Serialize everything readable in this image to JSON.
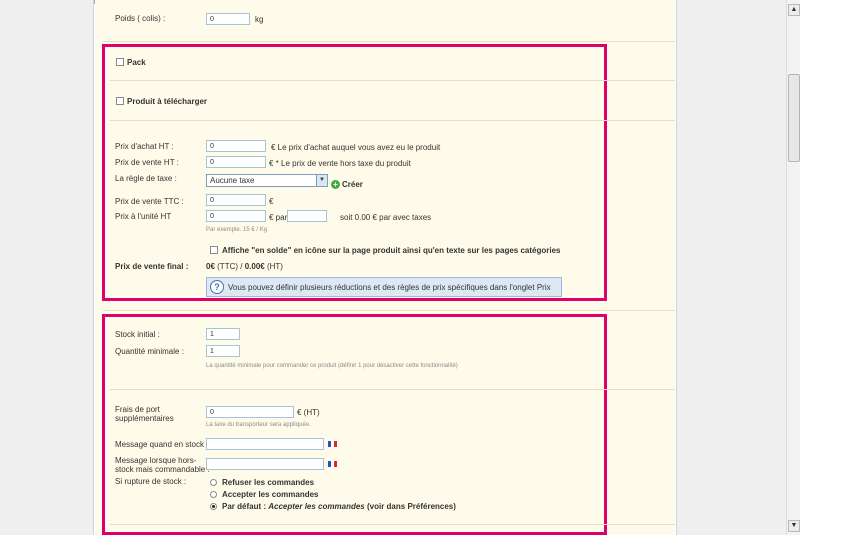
{
  "top": {
    "weight_label": "Poids ( colis) :",
    "weight_value": "0",
    "weight_unit": "kg"
  },
  "options": {
    "pack_label": "Pack",
    "download_label": "Produit à télécharger"
  },
  "prices": {
    "purchase_label": "Prix d'achat HT :",
    "purchase_value": "0",
    "purchase_note": "€  Le prix d'achat auquel vous avez eu le produit",
    "sale_ht_label": "Prix de vente HT :",
    "sale_ht_value": "0",
    "sale_ht_note": "€ *  Le prix de vente hors taxe du produit",
    "tax_rule_label": "La règle de taxe :",
    "tax_rule_selected": "Aucune taxe",
    "create_label": "Créer",
    "sale_ttc_label": "Prix de vente TTC :",
    "sale_ttc_value": "0",
    "sale_ttc_unit": "€",
    "unit_price_label": "Prix à l'unité HT",
    "unit_price_value": "0",
    "unit_price_per": "€ par",
    "unit_price_per_value": "",
    "unit_price_note": "soit 0.00 € par avec taxes",
    "unit_example": "Par exemple. 15 € / Kg",
    "on_sale_label": "Affiche \"en solde\" en icône sur la page produit ainsi qu'en texte sur les pages catégories",
    "final_label": "Prix de vente final :",
    "final_ttc": "0€",
    "final_ttc_suffix": "(TTC) /",
    "final_ht": "0.00€",
    "final_ht_suffix": "(HT)",
    "info_text": "Vous pouvez définir plusieurs réductions et des règles de prix spécifiques dans l'onglet Prix"
  },
  "stock": {
    "initial_label": "Stock initial :",
    "initial_value": "1",
    "min_qty_label": "Quantité minimale :",
    "min_qty_value": "1",
    "min_qty_hint": "La quantité minimale pour commander ce produit (définir 1 pour désactiver cette fonctionnalité)",
    "shipping_label_1": "Frais de port",
    "shipping_label_2": "supplémentaires",
    "shipping_value": "0",
    "shipping_unit": "€ (HT)",
    "shipping_hint": "La taxe du transporteur sera appliquée.",
    "msg_in_stock_label": "Message quand en stock :",
    "msg_in_stock_value": "",
    "msg_backorder_label_1": "Message lorsque hors-",
    "msg_backorder_label_2": "stock mais commandable :",
    "msg_backorder_value": "",
    "out_of_stock_label": "Si rupture de stock :",
    "opt_refuse": "Refuser les commandes",
    "opt_accept": "Accepter les commandes",
    "opt_default_prefix": "Par défaut :",
    "opt_default_value": "Accepter les commandes",
    "opt_default_suffix": "(voir dans Préférences)"
  },
  "colors": {
    "highlight": "#e0006d",
    "panel_bg": "#fffbea",
    "input_border": "#a9c3d6"
  }
}
